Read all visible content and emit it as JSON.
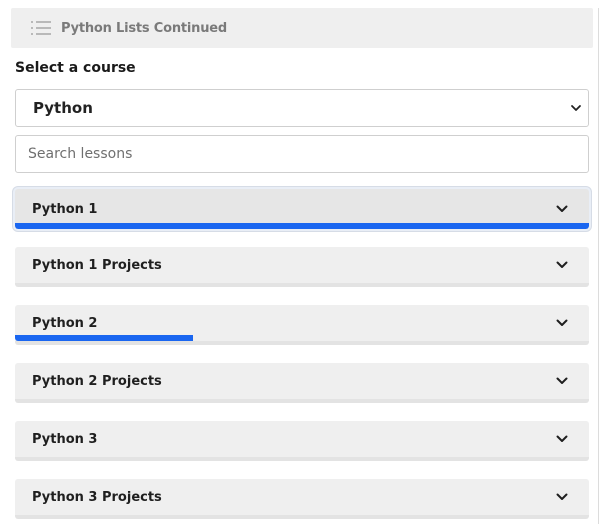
{
  "header": {
    "title": "Python Lists Continued",
    "icon": "list-icon"
  },
  "course_select": {
    "label": "Select a course",
    "value": "Python"
  },
  "search": {
    "placeholder": "Search lessons",
    "value": ""
  },
  "colors": {
    "accent": "#1a66f0",
    "panel": "#efefef"
  },
  "sections": [
    {
      "label": "Python 1",
      "progress": 1.0,
      "active": true
    },
    {
      "label": "Python 1 Projects",
      "progress": 0.0,
      "active": false
    },
    {
      "label": "Python 2",
      "progress": 0.31,
      "active": false
    },
    {
      "label": "Python 2 Projects",
      "progress": 0.0,
      "active": false
    },
    {
      "label": "Python 3",
      "progress": 0.0,
      "active": false
    },
    {
      "label": "Python 3 Projects",
      "progress": 0.0,
      "active": false
    }
  ]
}
